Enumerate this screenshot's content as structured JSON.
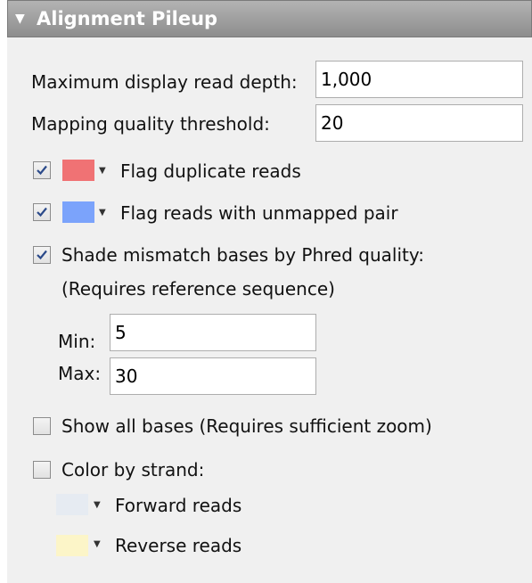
{
  "panel": {
    "title": "Alignment Pileup",
    "max_read_depth_label": "Maximum display read depth:",
    "max_read_depth_value": "1,000",
    "mapq_label": "Mapping quality threshold:",
    "mapq_value": "20",
    "flag_duplicates": {
      "checked": true,
      "label": "Flag duplicate reads",
      "color": "#f07274"
    },
    "flag_unmapped_pair": {
      "checked": true,
      "label": "Flag reads with unmapped pair",
      "color": "#7ba3fb"
    },
    "shade_mismatch": {
      "checked": true,
      "label": "Shade mismatch bases by Phred quality:",
      "note": "(Requires reference sequence)",
      "min_label": "Min:",
      "min_value": "5",
      "max_label": "Max:",
      "max_value": "30"
    },
    "show_all_bases": {
      "checked": false,
      "label": "Show all bases (Requires sufficient zoom)"
    },
    "color_by_strand": {
      "checked": false,
      "label": "Color by strand:",
      "forward_label": "Forward reads",
      "forward_color": "#e6ebf2",
      "reverse_label": "Reverse reads",
      "reverse_color": "#fcf5c8"
    }
  }
}
